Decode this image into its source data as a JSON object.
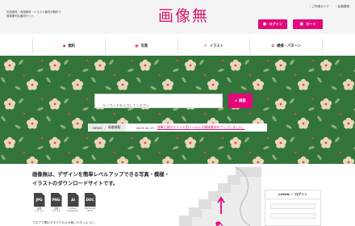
{
  "header": {
    "tagline": [
      "写真素材・商用素材・イラスト素材が無料で",
      "簡単便利な素材サイト"
    ],
    "logo": "画像無",
    "links": [
      "ご利用ガイド",
      "会員登録"
    ],
    "login_label": "ログイン",
    "cart_label": "カート"
  },
  "nav": {
    "items": [
      {
        "label": "無料",
        "icon": "tag-icon"
      },
      {
        "label": "写真",
        "icon": "camera-icon"
      },
      {
        "label": "イラスト",
        "icon": "pen-icon"
      },
      {
        "label": "模様・パターン",
        "icon": "pattern-icon"
      }
    ]
  },
  "search": {
    "placeholder": "キーワードを入力してください",
    "button_label": "検索"
  },
  "news": {
    "label": "NEWS",
    "separator": "/",
    "category": "新着情報",
    "date": "2019.04.19",
    "text": "直筆と間のイベント用シームレス模様素材をアップしました。"
  },
  "content": {
    "headline": "画像無は、デザインを簡単レベルアップできる写真・模様・イラストのダウンロードサイトです。",
    "filetypes": [
      {
        "ext": "JPG",
        "label": [
          "画像",
          "ファイル"
        ]
      },
      {
        "ext": "PNG",
        "label": [
          "画像",
          "ファイル"
        ]
      },
      {
        "ext": "AI",
        "label": [
          "Adobe",
          "Illustrator"
        ]
      },
      {
        "ext": "DOC",
        "label": [
          "Microsoft",
          "Word"
        ]
      }
    ],
    "description": "プロアマ問わずすべての人が使いやすいように、"
  },
  "login_panel": {
    "title": "LOGIN ／ ログイン"
  },
  "colors": {
    "accent": "#e4067b",
    "hero_green": "#33743a",
    "flower": "#ead6b8",
    "header_bg": "#f4f4f4"
  }
}
